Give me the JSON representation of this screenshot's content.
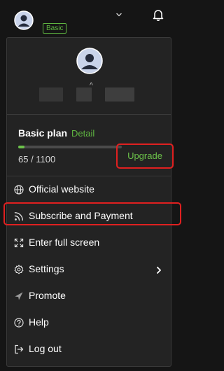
{
  "header": {
    "plan_badge": "Basic"
  },
  "profile": {
    "mark": "^"
  },
  "plan": {
    "title": "Basic plan",
    "detail_link": "Detail",
    "usage_text": "65 / 1100",
    "usage_fraction": 0.06,
    "upgrade_label": "Upgrade"
  },
  "menu": {
    "items": [
      {
        "label": "Official website",
        "icon": "globe-icon"
      },
      {
        "label": "Subscribe and Payment",
        "icon": "rss-icon"
      },
      {
        "label": "Enter full screen",
        "icon": "fullscreen-icon"
      },
      {
        "label": "Settings",
        "icon": "gear-icon"
      },
      {
        "label": "Promote",
        "icon": "send-icon"
      },
      {
        "label": "Help",
        "icon": "help-icon"
      },
      {
        "label": "Log out",
        "icon": "logout-icon"
      }
    ]
  },
  "colors": {
    "accent_green": "#5fb641",
    "highlight_red": "#e02020",
    "panel_bg": "#232323",
    "page_bg": "#151515"
  }
}
